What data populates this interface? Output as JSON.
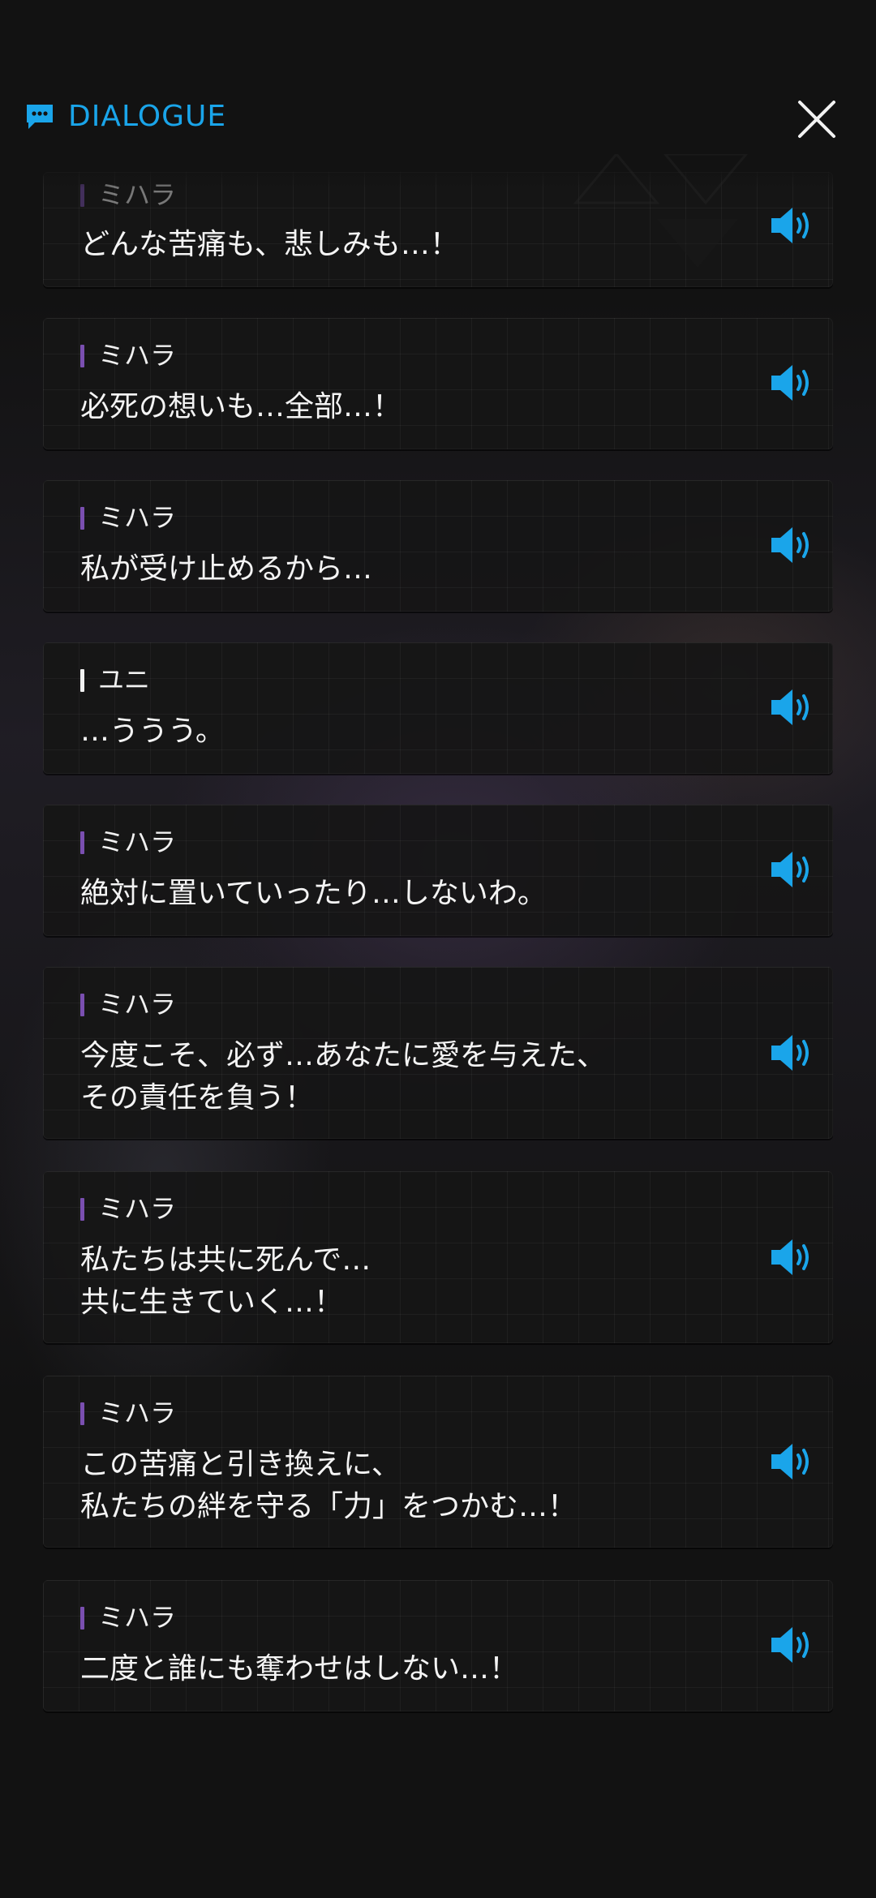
{
  "header": {
    "title": "DIALOGUE",
    "icon": "chat-bubble-icon",
    "close_icon": "close-icon"
  },
  "colors": {
    "accent": "#1aa5ea",
    "speaker_bar_mihara": "#7a4fb0",
    "speaker_bar_yuni": "#f2f2f2",
    "card_bg": "#161616",
    "page_bg": "#121212"
  },
  "entries": [
    {
      "speaker": "ミハラ",
      "text": "どんな苦痛も、悲しみも…！"
    },
    {
      "speaker": "ミハラ",
      "text": "必死の想いも…全部…！"
    },
    {
      "speaker": "ミハラ",
      "text": "私が受け止めるから…"
    },
    {
      "speaker": "ユニ",
      "text": "…ううう。"
    },
    {
      "speaker": "ミハラ",
      "text": "絶対に置いていったり…しないわ。"
    },
    {
      "speaker": "ミハラ",
      "text": "今度こそ、必ず…あなたに愛を与えた、\nその責任を負う！"
    },
    {
      "speaker": "ミハラ",
      "text": "私たちは共に死んで…\n共に生きていく…！"
    },
    {
      "speaker": "ミハラ",
      "text": "この苦痛と引き換えに、\n私たちの絆を守る「力」をつかむ…！"
    },
    {
      "speaker": "ミハラ",
      "text": "二度と誰にも奪わせはしない…！"
    }
  ]
}
